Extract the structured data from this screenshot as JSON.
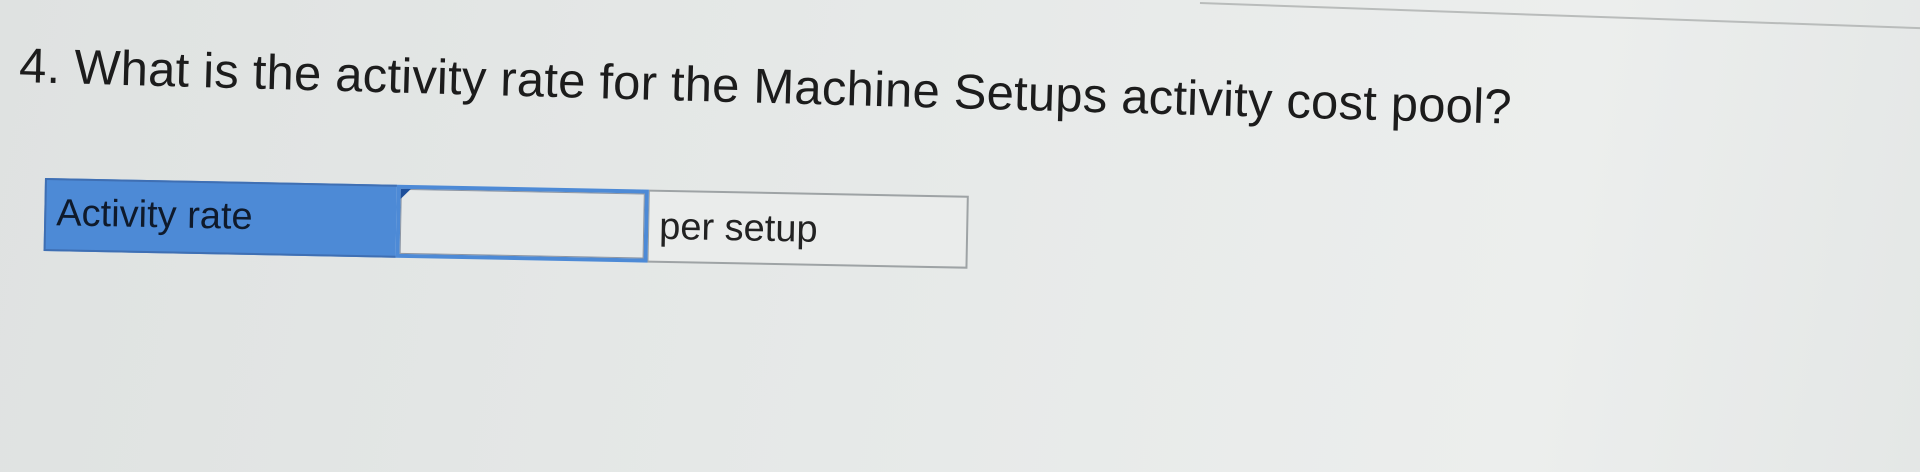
{
  "question": {
    "text": "4. What is the activity rate for the Machine Setups activity cost pool?"
  },
  "answer_row": {
    "label": "Activity rate",
    "input_value": "",
    "unit": "per setup"
  }
}
